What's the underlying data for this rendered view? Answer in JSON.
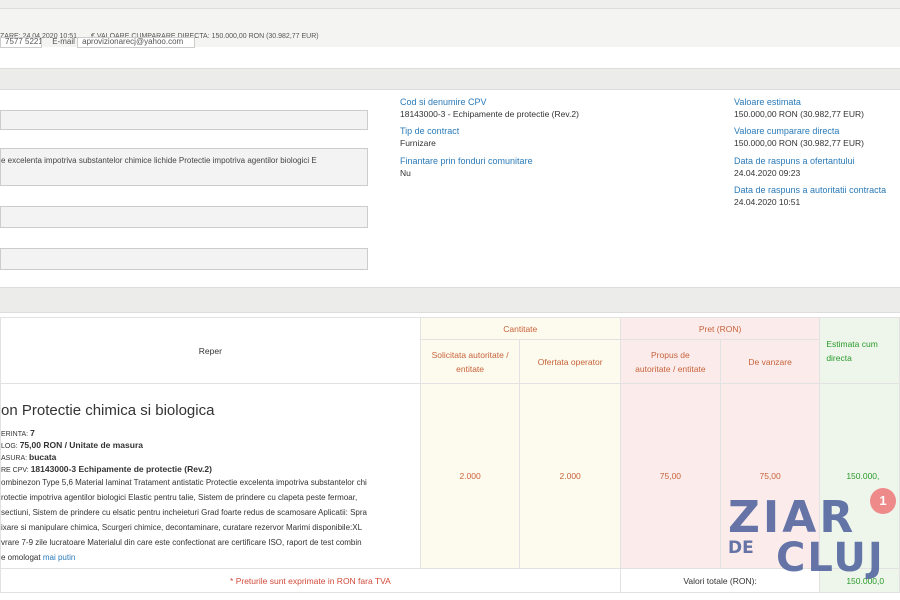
{
  "header": {
    "date_publicare": "ZARE: 24.04.2020 10:51",
    "valoare_directa": "€ VALOARE CUMPARARE DIRECTA: 150.000,00  RON (30.982,77  EUR)",
    "phone_partial": "7577 5221",
    "email_label": "E-mail",
    "email_value": "aprovizionarecj@yahoo.com"
  },
  "form": {
    "field1_value": "",
    "field2_value": "e excelenta impotriva substantelor chimice lichide Protectie impotriva agentilor biologici E",
    "field3_value": "",
    "field4_value": ""
  },
  "details": {
    "cpv_label": "Cod si denumire CPV",
    "cpv_value": "18143000-3 - Echipamente de protectie (Rev.2)",
    "contract_label": "Tip de contract",
    "contract_value": "Furnizare",
    "fonduri_label": "Finantare prin fonduri comunitare",
    "fonduri_value": "Nu",
    "val_estimata_label": "Valoare estimata",
    "val_estimata_value": "150.000,00  RON (30.982,77  EUR)",
    "val_directa_label": "Valoare cumparare directa",
    "val_directa_value": "150.000,00  RON (30.982,77  EUR)",
    "raspuns_ofertant_label": "Data de raspuns a ofertantului",
    "raspuns_ofertant_value": "24.04.2020 09:23",
    "raspuns_autoritate_label": "Data de raspuns a autoritatii contracta",
    "raspuns_autoritate_value": "24.04.2020 10:51"
  },
  "table": {
    "reper_header": "Reper",
    "cantitate_header": "Cantitate",
    "pret_header": "Pret (RON)",
    "solicitata_header": "Solicitata autoritate / entitate",
    "ofertata_header": "Ofertata operator",
    "propus_header": "Propus de autoritate / entitate",
    "vanzare_header": "De vanzare",
    "estimata_header": "Estimata cum directa",
    "row": {
      "title": "on Protectie chimica si biologica",
      "cerinta_label": "ERINTA:",
      "cerinta_value": "7",
      "pret_label": "LOG:",
      "pret_value": "75,00  RON / Unitate de masura",
      "um_label": "ASURA:",
      "um_value": "bucata",
      "cpv_label": "RE CPV:",
      "cpv_value": "18143000-3 Echipamente de protectie (Rev.2)",
      "desc1": "ombinezon Type 5,6 Material laminat Tratament antistatic Protectie excelenta impotriva substantelor chi",
      "desc2": "rotectie impotriva agentilor biologici Elastic pentru talie, Sistem de prindere cu clapeta peste fermoar,",
      "desc3": "sectiuni, Sistem de prindere cu elsatic pentru incheieturi Grad foarte redus de scamosare Aplicatii: Spra",
      "desc4": "ixare si manipulare chimica, Scurgeri chimice, decontaminare, curatare rezervor Marimi disponibile:XL",
      "desc5": "vrare 7-9 zile lucratoare Materialul din care este confectionat are certificare ISO, raport de test combin",
      "desc6": "e omologat",
      "more_link": "mai putin",
      "solicitata": "2.000",
      "ofertata": "2.000",
      "propus": "75,00",
      "vanzare": "75,00",
      "estimata": "150.000,"
    },
    "footer_note": "* Preturile sunt exprimate in RON fara TVA",
    "totals_label": "Valori totale (RON):",
    "totals_value": "150.000,0"
  },
  "watermark": {
    "word1": "ZIAR",
    "word2": "DE",
    "word3": "CLUJ",
    "badge": "1"
  },
  "colors": {
    "link": "#2a7ab8",
    "accent_orange": "#c8623a",
    "accent_green": "#2a9a2a",
    "logo": "#4b5f9c"
  }
}
